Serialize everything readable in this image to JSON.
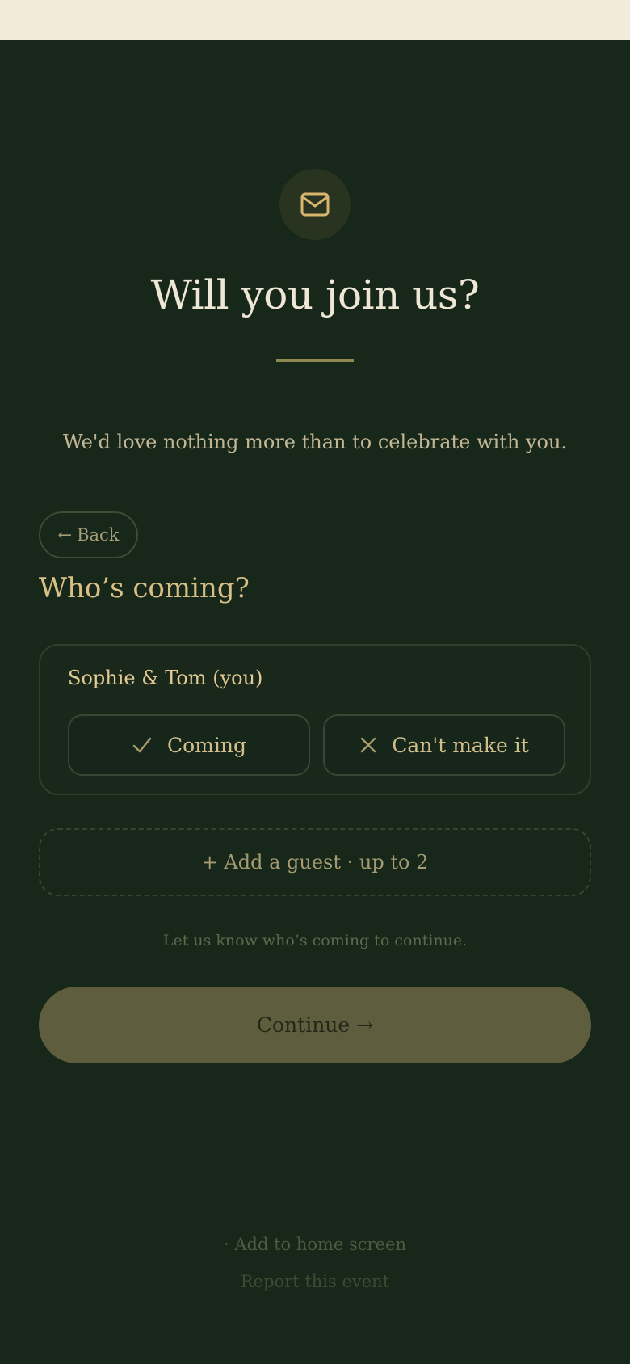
{
  "header": {
    "title": "Will you join us?",
    "subtitle": "We'd love nothing more than to celebrate with you.",
    "icon": "envelope-icon"
  },
  "nav": {
    "back_label": "Back"
  },
  "section": {
    "title": "Who’s coming?"
  },
  "guest": {
    "name": "Sophie & Tom (you)",
    "coming_label": "Coming",
    "cant_label": "Can't make it"
  },
  "add_guest": {
    "label": "+ Add a guest · up to 2"
  },
  "hint": "Let us know who’s coming to continue.",
  "continue_label": "Continue",
  "footer": {
    "home_label": "· Add to home screen",
    "report_label": "Report this event"
  },
  "colors": {
    "background": "#17271a",
    "accent": "#d8bf86",
    "button": "#5e5d3d"
  }
}
